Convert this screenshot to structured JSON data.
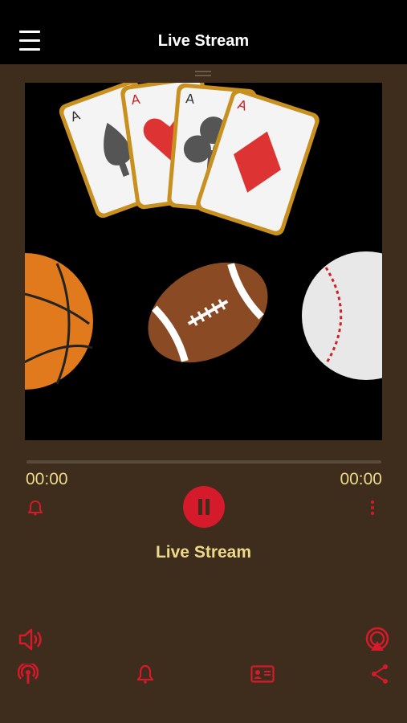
{
  "header": {
    "title": "Live Stream",
    "menu_icon": "hamburger-menu-icon"
  },
  "player": {
    "artwork_icons": [
      "ace-of-spades-card",
      "ace-of-hearts-card",
      "ace-of-clubs-card",
      "ace-of-diamonds-card",
      "basketball",
      "american-football",
      "baseball"
    ],
    "elapsed": "00:00",
    "duration": "00:00",
    "progress": 0,
    "now_playing": "Live Stream",
    "state": "playing"
  },
  "controls": {
    "alarm_icon": "bell-icon",
    "pause_icon": "pause-icon",
    "more_icon": "vertical-ellipsis-icon",
    "volume_icon": "speaker-icon",
    "airplay_icon": "airplay-icon",
    "podcast_icon": "podcast-icon",
    "bottom_alarm_icon": "bell-icon",
    "contact_icon": "contact-card-icon",
    "share_icon": "share-icon"
  },
  "colors": {
    "background": "#3e2c1c",
    "topbar": "#000000",
    "accent": "#d41a2b",
    "text": "#ecd98a"
  }
}
